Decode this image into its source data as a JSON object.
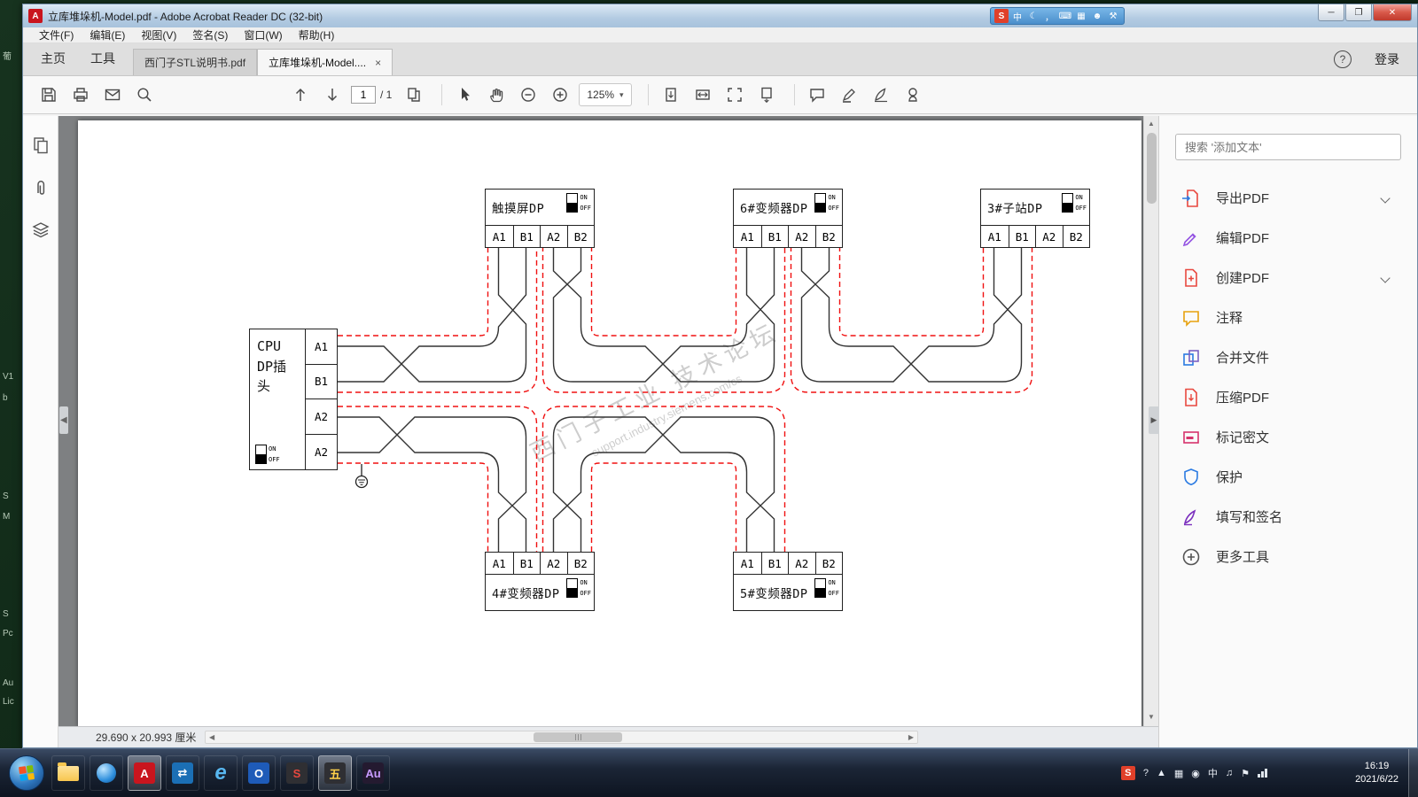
{
  "desktop": {
    "fragments": [
      "葡",
      "V1",
      "b",
      "S",
      "M",
      "S",
      "Pc",
      "Au",
      "Lic"
    ]
  },
  "title_bar": {
    "title": "立库堆垛机-Model.pdf - Adobe Acrobat Reader DC (32-bit)",
    "ime_icons": [
      "S",
      "中",
      "☾",
      "，",
      "⌨",
      "▦",
      "☻",
      "⚒"
    ]
  },
  "menubar": {
    "items": [
      "文件(F)",
      "编辑(E)",
      "视图(V)",
      "签名(S)",
      "窗口(W)",
      "帮助(H)"
    ]
  },
  "tabbar": {
    "home": "主页",
    "tools": "工具",
    "tabs": [
      "西门子STL说明书.pdf",
      "立库堆垛机-Model...."
    ],
    "help": "?",
    "sign_in": "登录"
  },
  "toolbar": {
    "page_current": "1",
    "page_total": "/ 1",
    "zoom_level": "125%"
  },
  "right_panel": {
    "search_placeholder": "搜索 '添加文本'",
    "tools": [
      {
        "label": "导出PDF",
        "icon": "export-pdf-icon",
        "expandable": true
      },
      {
        "label": "编辑PDF",
        "icon": "edit-pdf-icon",
        "expandable": false
      },
      {
        "label": "创建PDF",
        "icon": "create-pdf-icon",
        "expandable": true
      },
      {
        "label": "注释",
        "icon": "comment-icon",
        "expandable": false
      },
      {
        "label": "合并文件",
        "icon": "combine-files-icon",
        "expandable": false
      },
      {
        "label": "压缩PDF",
        "icon": "compress-pdf-icon",
        "expandable": false
      },
      {
        "label": "标记密文",
        "icon": "redact-icon",
        "expandable": false
      },
      {
        "label": "保护",
        "icon": "protect-icon",
        "expandable": false
      },
      {
        "label": "填写和签名",
        "icon": "fill-sign-icon",
        "expandable": false
      },
      {
        "label": "更多工具",
        "icon": "more-tools-icon",
        "expandable": false
      }
    ]
  },
  "statusbar": {
    "page_size": "29.690 x 20.993 厘米"
  },
  "diagram": {
    "cpu": {
      "lines": [
        "CPU",
        "DP插",
        "头"
      ],
      "terminals": [
        "A1",
        "B1",
        "A2",
        "A2"
      ]
    },
    "switch_on": "ON",
    "switch_off": "OFF",
    "devices": [
      {
        "label": "触摸屏DP",
        "terminals": [
          "A1",
          "B1",
          "A2",
          "B2"
        ]
      },
      {
        "label": "6#变频器DP",
        "terminals": [
          "A1",
          "B1",
          "A2",
          "B2"
        ]
      },
      {
        "label": "3#子站DP",
        "terminals": [
          "A1",
          "B1",
          "A2",
          "B2"
        ]
      },
      {
        "label": "4#变频器DP",
        "terminals": [
          "A1",
          "B1",
          "A2",
          "B2"
        ]
      },
      {
        "label": "5#变频器DP",
        "terminals": [
          "A1",
          "B1",
          "A2",
          "B2"
        ]
      }
    ],
    "watermark": {
      "line1": "西门子工业 技术论坛",
      "line2": "support.industry.siemens.com/cs"
    },
    "colors": {
      "cable_shield": "#f01010",
      "conductor": "#333333"
    }
  },
  "taskbar": {
    "time": "16:19",
    "date": "2021/6/22",
    "apps": [
      {
        "name": "explorer",
        "glyph": ""
      },
      {
        "name": "media-player",
        "glyph": ""
      },
      {
        "name": "acrobat-reader",
        "glyph": "A"
      },
      {
        "name": "remote-app",
        "glyph": "⇄"
      },
      {
        "name": "internet-explorer",
        "glyph": "e"
      },
      {
        "name": "outlook",
        "glyph": "O"
      },
      {
        "name": "screenshot-tool",
        "glyph": "S"
      },
      {
        "name": "ime-app",
        "glyph": "五"
      },
      {
        "name": "audition",
        "glyph": "Au"
      }
    ],
    "tray": [
      "S",
      "?",
      "▲",
      "▦",
      "◉",
      "中",
      "♫",
      "⚑"
    ]
  }
}
